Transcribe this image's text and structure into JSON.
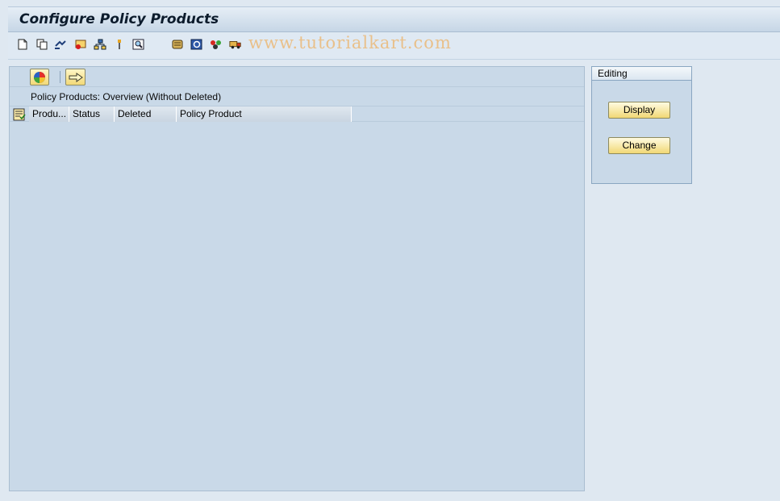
{
  "header": {
    "title": "Configure Policy Products"
  },
  "toolbar": {
    "icons": [
      "new-document-icon",
      "copy-icon",
      "link-icon",
      "mail-icon",
      "hierarchy-icon",
      "pin-icon",
      "find-icon",
      "scroll-icon",
      "refresh-icon",
      "transport-icon",
      "truck-icon"
    ],
    "watermark": "www.tutorialkart.com"
  },
  "main": {
    "overview_title": "Policy Products: Overview (Without Deleted)",
    "columns": [
      "Produ...",
      "Status",
      "Deleted",
      "Policy Product"
    ]
  },
  "editing": {
    "title": "Editing",
    "display_label": "Display",
    "change_label": "Change"
  }
}
